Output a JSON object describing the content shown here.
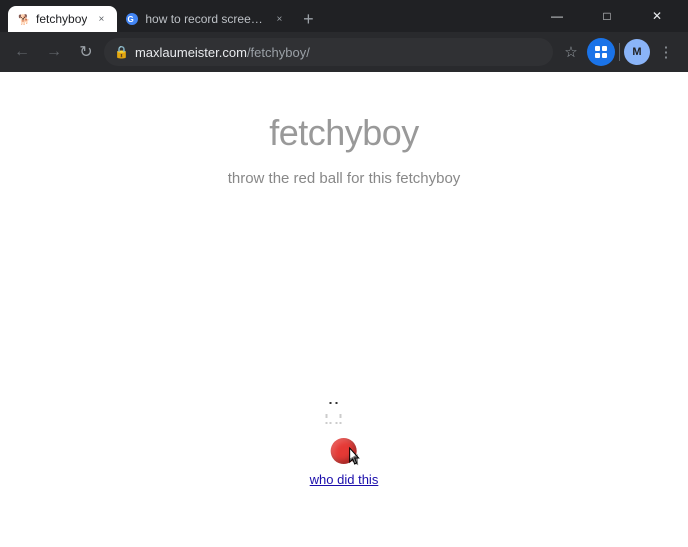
{
  "titlebar": {
    "tabs": [
      {
        "id": "tab-fetchyboy",
        "label": "fetchyboy",
        "favicon_type": "dog",
        "active": true,
        "close_label": "×"
      },
      {
        "id": "tab-search",
        "label": "how to record screen on wind…",
        "favicon_type": "google",
        "active": false,
        "close_label": "×"
      }
    ],
    "new_tab_label": "+",
    "window_controls": {
      "minimize": "—",
      "maximize": "□",
      "close": "✕"
    }
  },
  "omnibar": {
    "back_tooltip": "Back",
    "forward_tooltip": "Forward",
    "refresh_tooltip": "Reload",
    "address_base": "maxlaumeister.com",
    "address_path": "/fetchyboy/",
    "star_tooltip": "Bookmark",
    "extensions_tooltip": "Extensions",
    "menu_tooltip": "More"
  },
  "page": {
    "title": "fetchyboy",
    "subtitle": "throw the red ball for this fetchyboy",
    "who_did_this": "who did this"
  }
}
